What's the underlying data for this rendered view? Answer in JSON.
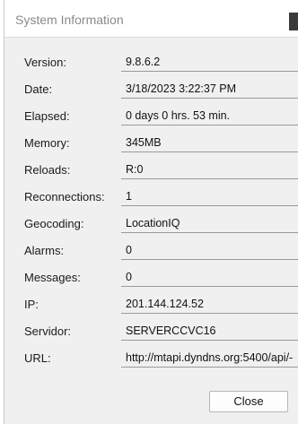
{
  "window": {
    "title": "System Information"
  },
  "fields": [
    {
      "label": "Version:",
      "value": "9.8.6.2"
    },
    {
      "label": "Date:",
      "value": "3/18/2023 3:22:37 PM"
    },
    {
      "label": "Elapsed:",
      "value": "0 days 0 hrs. 53 min."
    },
    {
      "label": "Memory:",
      "value": "345MB"
    },
    {
      "label": "Reloads:",
      "value": "R:0"
    },
    {
      "label": "Reconnections:",
      "value": "1"
    },
    {
      "label": "Geocoding:",
      "value": "LocationIQ"
    },
    {
      "label": "Alarms:",
      "value": "0"
    },
    {
      "label": "Messages:",
      "value": "0"
    },
    {
      "label": "IP:",
      "value": "201.144.124.52"
    },
    {
      "label": "Servidor:",
      "value": "SERVERCCVC16"
    },
    {
      "label": "URL:",
      "value": "http://mtapi.dyndns.org:5400/api/-"
    }
  ],
  "buttons": {
    "close_label": "Close"
  }
}
